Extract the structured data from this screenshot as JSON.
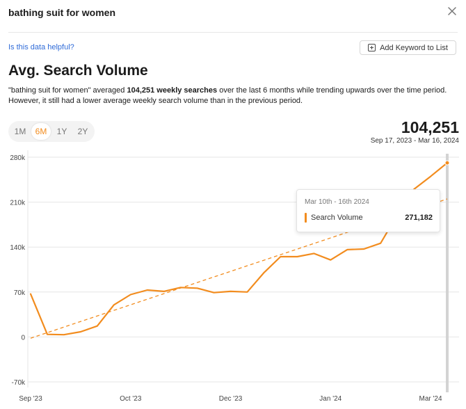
{
  "header": {
    "keyword": "bathing suit for women"
  },
  "links": {
    "helpful": "Is this data helpful?"
  },
  "actions": {
    "add_keyword": "Add Keyword to List"
  },
  "section": {
    "title": "Avg. Search Volume"
  },
  "summary": {
    "part1": "\"bathing suit for women\" averaged ",
    "bold": "104,251 weekly searches",
    "part2": " over the last 6 months while trending upwards over the time period. However, it still had a lower average weekly search volume than in the previous period."
  },
  "range_tabs": [
    {
      "label": "1M",
      "active": false
    },
    {
      "label": "6M",
      "active": true
    },
    {
      "label": "1Y",
      "active": false
    },
    {
      "label": "2Y",
      "active": false
    }
  ],
  "stats": {
    "average": "104,251",
    "date_range": "Sep 17, 2023 - Mar 16, 2024"
  },
  "tooltip": {
    "date": "Mar 10th - 16th 2024",
    "label": "Search Volume",
    "value": "271,182"
  },
  "colors": {
    "accent": "#f28c1e",
    "grid": "#e6e6e6"
  },
  "chart_data": {
    "type": "line",
    "series": [
      {
        "name": "Search Volume",
        "values": [
          67000,
          4000,
          3500,
          8000,
          17000,
          50000,
          66000,
          73000,
          71000,
          77000,
          76000,
          69000,
          71000,
          70000,
          100000,
          125000,
          125000,
          130000,
          120000,
          136000,
          137000,
          146000,
          190000,
          230000,
          250000,
          271182
        ]
      }
    ],
    "x_ticks": [
      {
        "index": 0,
        "label": "Sep '23"
      },
      {
        "index": 6,
        "label": "Oct '23"
      },
      {
        "index": 12,
        "label": "Dec '23"
      },
      {
        "index": 18,
        "label": "Jan '24"
      },
      {
        "index": 24,
        "label": "Mar '24"
      }
    ],
    "y_ticks": [
      -70000,
      0,
      70000,
      140000,
      210000,
      280000
    ],
    "y_tick_labels": [
      "-70k",
      "0",
      "70k",
      "140k",
      "210k",
      "280k"
    ],
    "ylim": [
      -70000,
      280000
    ],
    "trend": {
      "start": -2000,
      "end": 215000
    },
    "highlight_index": 25,
    "grid": true
  }
}
